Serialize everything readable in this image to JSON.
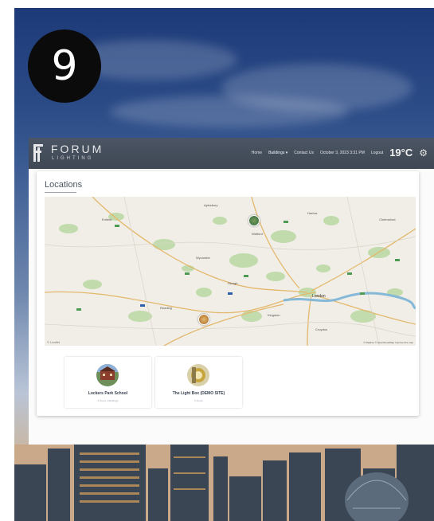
{
  "step_badge": "9",
  "brand": {
    "title": "FORUM",
    "subtitle": "LIGHTING"
  },
  "nav": {
    "items": [
      "Home",
      "Buildings",
      "Contact Us"
    ],
    "active": "Buildings",
    "datetime": "October 3, 2023 3:31 PM",
    "logout": "Logout",
    "temperature": "19°C"
  },
  "icons": [
    "gear-icon",
    "map-marker-icon",
    "building-photo-icon"
  ],
  "page": {
    "title": "Locations"
  },
  "map": {
    "labels": [
      "Aylesbury",
      "Enfield",
      "Harlow",
      "Wycombe",
      "Watford",
      "Chelmsford",
      "Slough",
      "London",
      "Croydon",
      "Reading",
      "Kingston"
    ],
    "leaflet_attribution": "© Leaflet",
    "tiles_attribution": "© Mapbox © OpenStreetMap Improve this map"
  },
  "locations": [
    {
      "name": "Lockers Park School",
      "sub": "2 Floors  4 Buildings"
    },
    {
      "name": "The Light Box (DEMO SITE)",
      "sub": "2 Floors"
    }
  ],
  "colors": {
    "header": "#434b57",
    "map_bg": "#f0eee7",
    "river": "#86b8d8",
    "park": "#b7d6a2",
    "road": "#e4b86c"
  }
}
